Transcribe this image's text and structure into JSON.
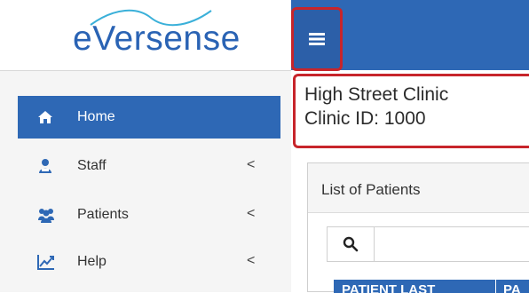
{
  "logo": {
    "text": "eVersense"
  },
  "sidebar": {
    "items": [
      {
        "label": "Home",
        "icon": "home-icon",
        "active": true,
        "has_chevron": false
      },
      {
        "label": "Staff",
        "icon": "staff-icon",
        "active": false,
        "has_chevron": true
      },
      {
        "label": "Patients",
        "icon": "patients-icon",
        "active": false,
        "has_chevron": true
      },
      {
        "label": "Help",
        "icon": "chart-line-icon",
        "active": false,
        "has_chevron": true
      }
    ],
    "chevron_glyph": "<"
  },
  "header": {
    "menu_icon": "hamburger-menu-icon"
  },
  "clinic": {
    "name": "High Street Clinic",
    "id_line": "Clinic ID: 1000"
  },
  "patients_panel": {
    "title": "List of Patients",
    "search_icon": "search-icon",
    "columns": [
      "PATIENT LAST",
      "PA"
    ]
  },
  "colors": {
    "primary_blue": "#2e68b5",
    "highlight_red": "#c7252b",
    "sidebar_bg": "#f5f5f5"
  }
}
